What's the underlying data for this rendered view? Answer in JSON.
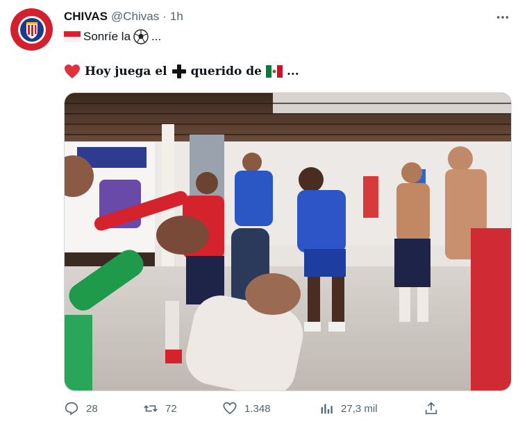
{
  "tweet": {
    "display_name": "CHIVAS",
    "handle": "@Chivas",
    "separator": "·",
    "time": "1h",
    "line1_text": "Sonríe la",
    "line1_suffix": "...",
    "line2_text": "Hoy juega el",
    "line2_mid": "querido de",
    "line2_suffix": "..."
  },
  "icons": {
    "avatar": "chivas-crest-icon",
    "more": "more-options-icon",
    "flag_indonesia": "flag-icon",
    "soccer": "soccer-ball-icon",
    "heart": "red-heart-icon",
    "plus": "heavy-plus-icon",
    "flag_mexico": "mexico-flag-icon"
  },
  "stats": {
    "replies": "28",
    "retweets": "72",
    "likes": "1.348",
    "views": "27,3 mil"
  },
  "colors": {
    "brand_red": "#d4202c",
    "text": "#0f1419",
    "muted": "#536471"
  }
}
